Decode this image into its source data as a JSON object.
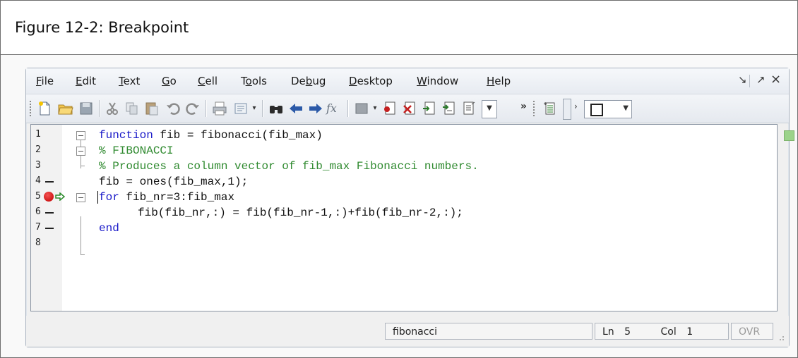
{
  "figure": {
    "caption": "Figure 12-2: Breakpoint"
  },
  "menu": {
    "items": [
      {
        "label": "File",
        "ul": "F",
        "rest": "ile"
      },
      {
        "label": "Edit",
        "ul": "E",
        "rest": "dit"
      },
      {
        "label": "Text",
        "ul": "T",
        "rest": "ext"
      },
      {
        "label": "Go",
        "ul": "G",
        "rest": "o"
      },
      {
        "label": "Cell",
        "ul": "C",
        "rest": "ell"
      },
      {
        "label": "Tools",
        "pre": "T",
        "ul": "o",
        "rest": "ols"
      },
      {
        "label": "Debug",
        "pre": "De",
        "ul": "b",
        "rest": "ug"
      },
      {
        "label": "Desktop",
        "ul": "D",
        "rest": "esktop"
      },
      {
        "label": "Window",
        "ul": "W",
        "rest": "indow"
      },
      {
        "label": "Help",
        "ul": "H",
        "rest": "elp"
      }
    ],
    "window_controls": [
      "↘",
      "↗",
      "×"
    ]
  },
  "toolbar": {
    "icons": [
      "new-file-icon",
      "open-folder-icon",
      "save-icon",
      "cut-icon",
      "copy-icon",
      "paste-icon",
      "undo-icon",
      "redo-icon",
      "print-icon",
      "publish-icon",
      "find-icon",
      "back-icon",
      "forward-icon",
      "function-icon",
      "stack-icon",
      "set-breakpoint-icon",
      "clear-breakpoints-icon",
      "step-icon",
      "step-in-icon",
      "step-out-icon",
      "more-icon",
      "cell-icon",
      "layout-icon"
    ],
    "fx_label": "fx",
    "overflow_label": "»"
  },
  "code": {
    "lines": [
      {
        "num": "1",
        "dash": false,
        "segments": [
          {
            "t": "function",
            "c": "kw"
          },
          {
            "t": " fib = fibonacci(fib_max)",
            "c": ""
          }
        ]
      },
      {
        "num": "2",
        "dash": false,
        "segments": [
          {
            "t": "% FIBONACCI",
            "c": "cm"
          }
        ]
      },
      {
        "num": "3",
        "dash": false,
        "segments": [
          {
            "t": "% Produces a column vector of fib_max Fibonacci numbers.",
            "c": "cm"
          }
        ]
      },
      {
        "num": "4",
        "dash": true,
        "segments": [
          {
            "t": "fib = ones(fib_max,1);",
            "c": ""
          }
        ]
      },
      {
        "num": "5",
        "dash": false,
        "segments": [
          {
            "t": "for",
            "c": "kw"
          },
          {
            "t": " fib_nr=3:fib_max",
            "c": ""
          }
        ]
      },
      {
        "num": "6",
        "dash": true,
        "segments": [
          {
            "t": "fib(fib_nr,:) = fib(fib_nr-1,:)+fib(fib_nr-2,:);",
            "c": ""
          }
        ]
      },
      {
        "num": "7",
        "dash": true,
        "segments": [
          {
            "t": "end",
            "c": "kw"
          }
        ]
      },
      {
        "num": "8",
        "dash": false,
        "segments": []
      }
    ],
    "breakpoint_line": 5
  },
  "status": {
    "function_name": "fibonacci",
    "ln_label": "Ln",
    "ln_value": "5",
    "col_label": "Col",
    "col_value": "1",
    "ovr": "OVR"
  }
}
